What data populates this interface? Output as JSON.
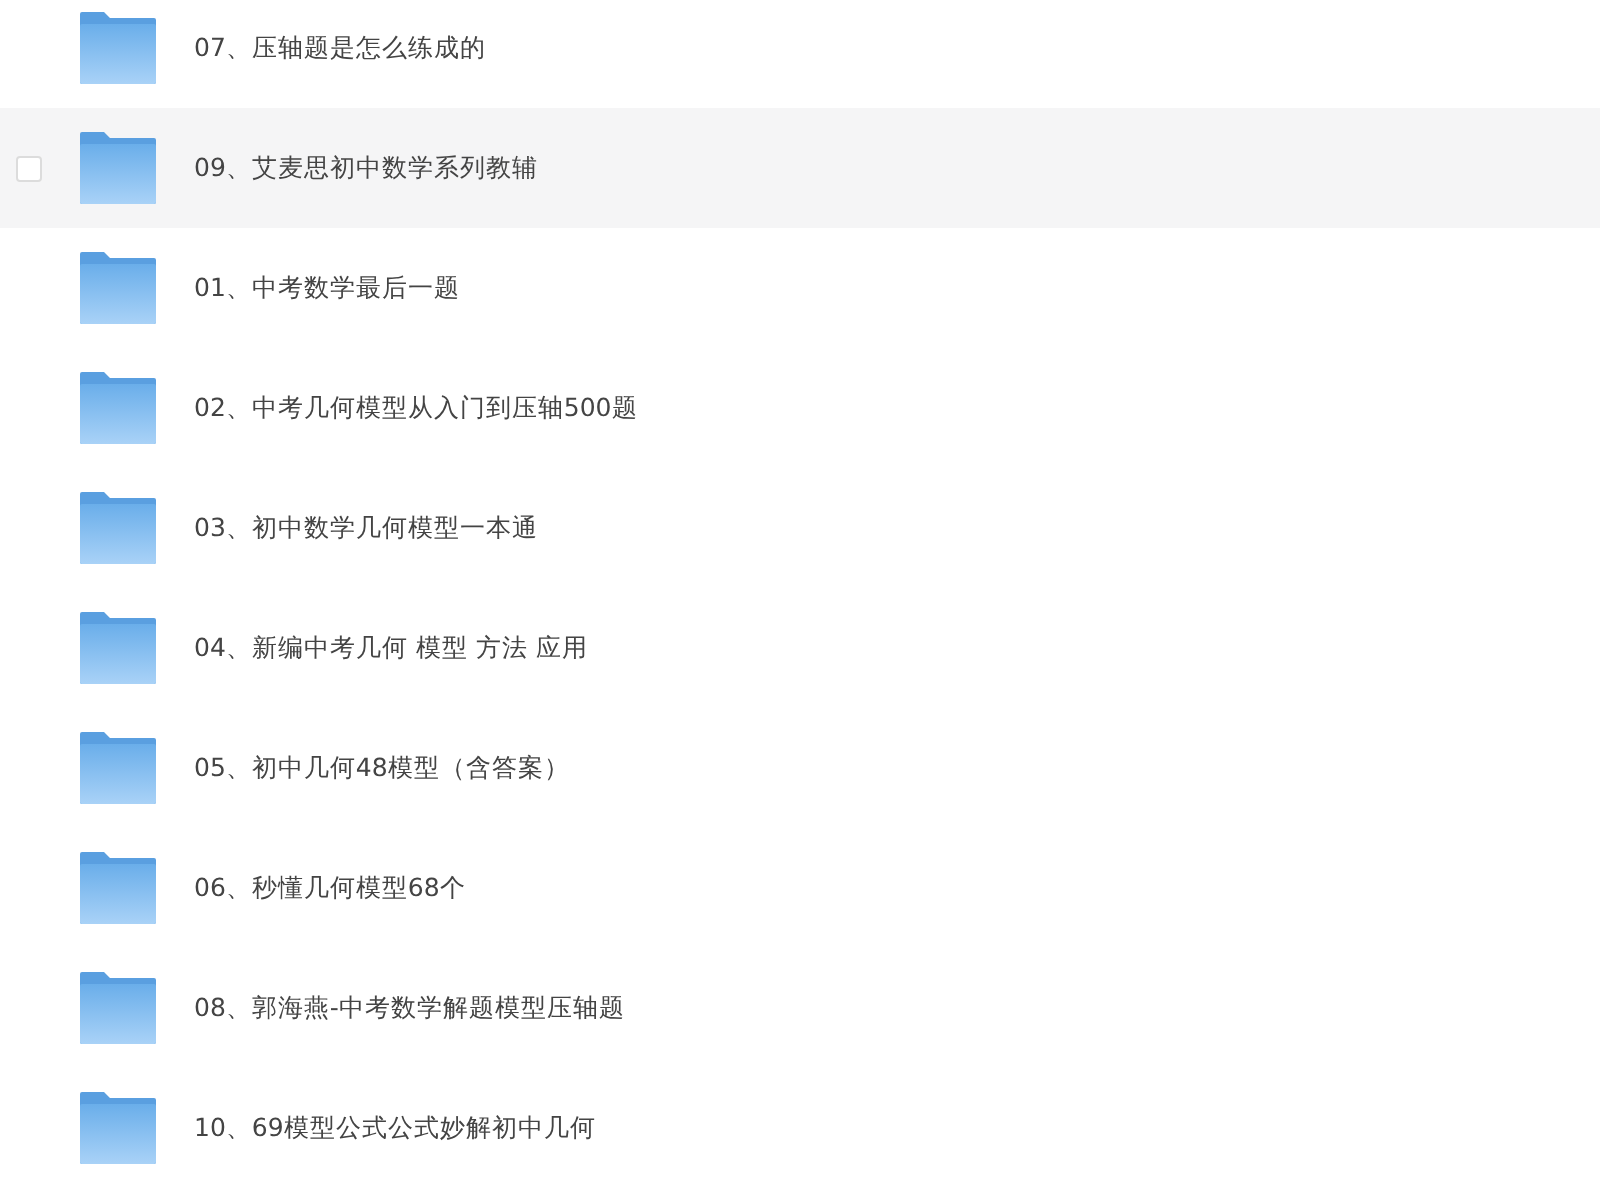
{
  "folders": [
    {
      "name": "07、压轴题是怎么练成的",
      "highlighted": false,
      "checked": false
    },
    {
      "name": "09、艾麦思初中数学系列教辅",
      "highlighted": true,
      "checked": false
    },
    {
      "name": "01、中考数学最后一题",
      "highlighted": false,
      "checked": false
    },
    {
      "name": "02、中考几何模型从入门到压轴500题",
      "highlighted": false,
      "checked": false
    },
    {
      "name": "03、初中数学几何模型一本通",
      "highlighted": false,
      "checked": false
    },
    {
      "name": "04、新编中考几何 模型 方法 应用",
      "highlighted": false,
      "checked": false
    },
    {
      "name": "05、初中几何48模型（含答案）",
      "highlighted": false,
      "checked": false
    },
    {
      "name": "06、秒懂几何模型68个",
      "highlighted": false,
      "checked": false
    },
    {
      "name": "08、郭海燕-中考数学解题模型压轴题",
      "highlighted": false,
      "checked": false
    },
    {
      "name": "10、69模型公式公式妙解初中几何",
      "highlighted": false,
      "checked": false
    }
  ]
}
